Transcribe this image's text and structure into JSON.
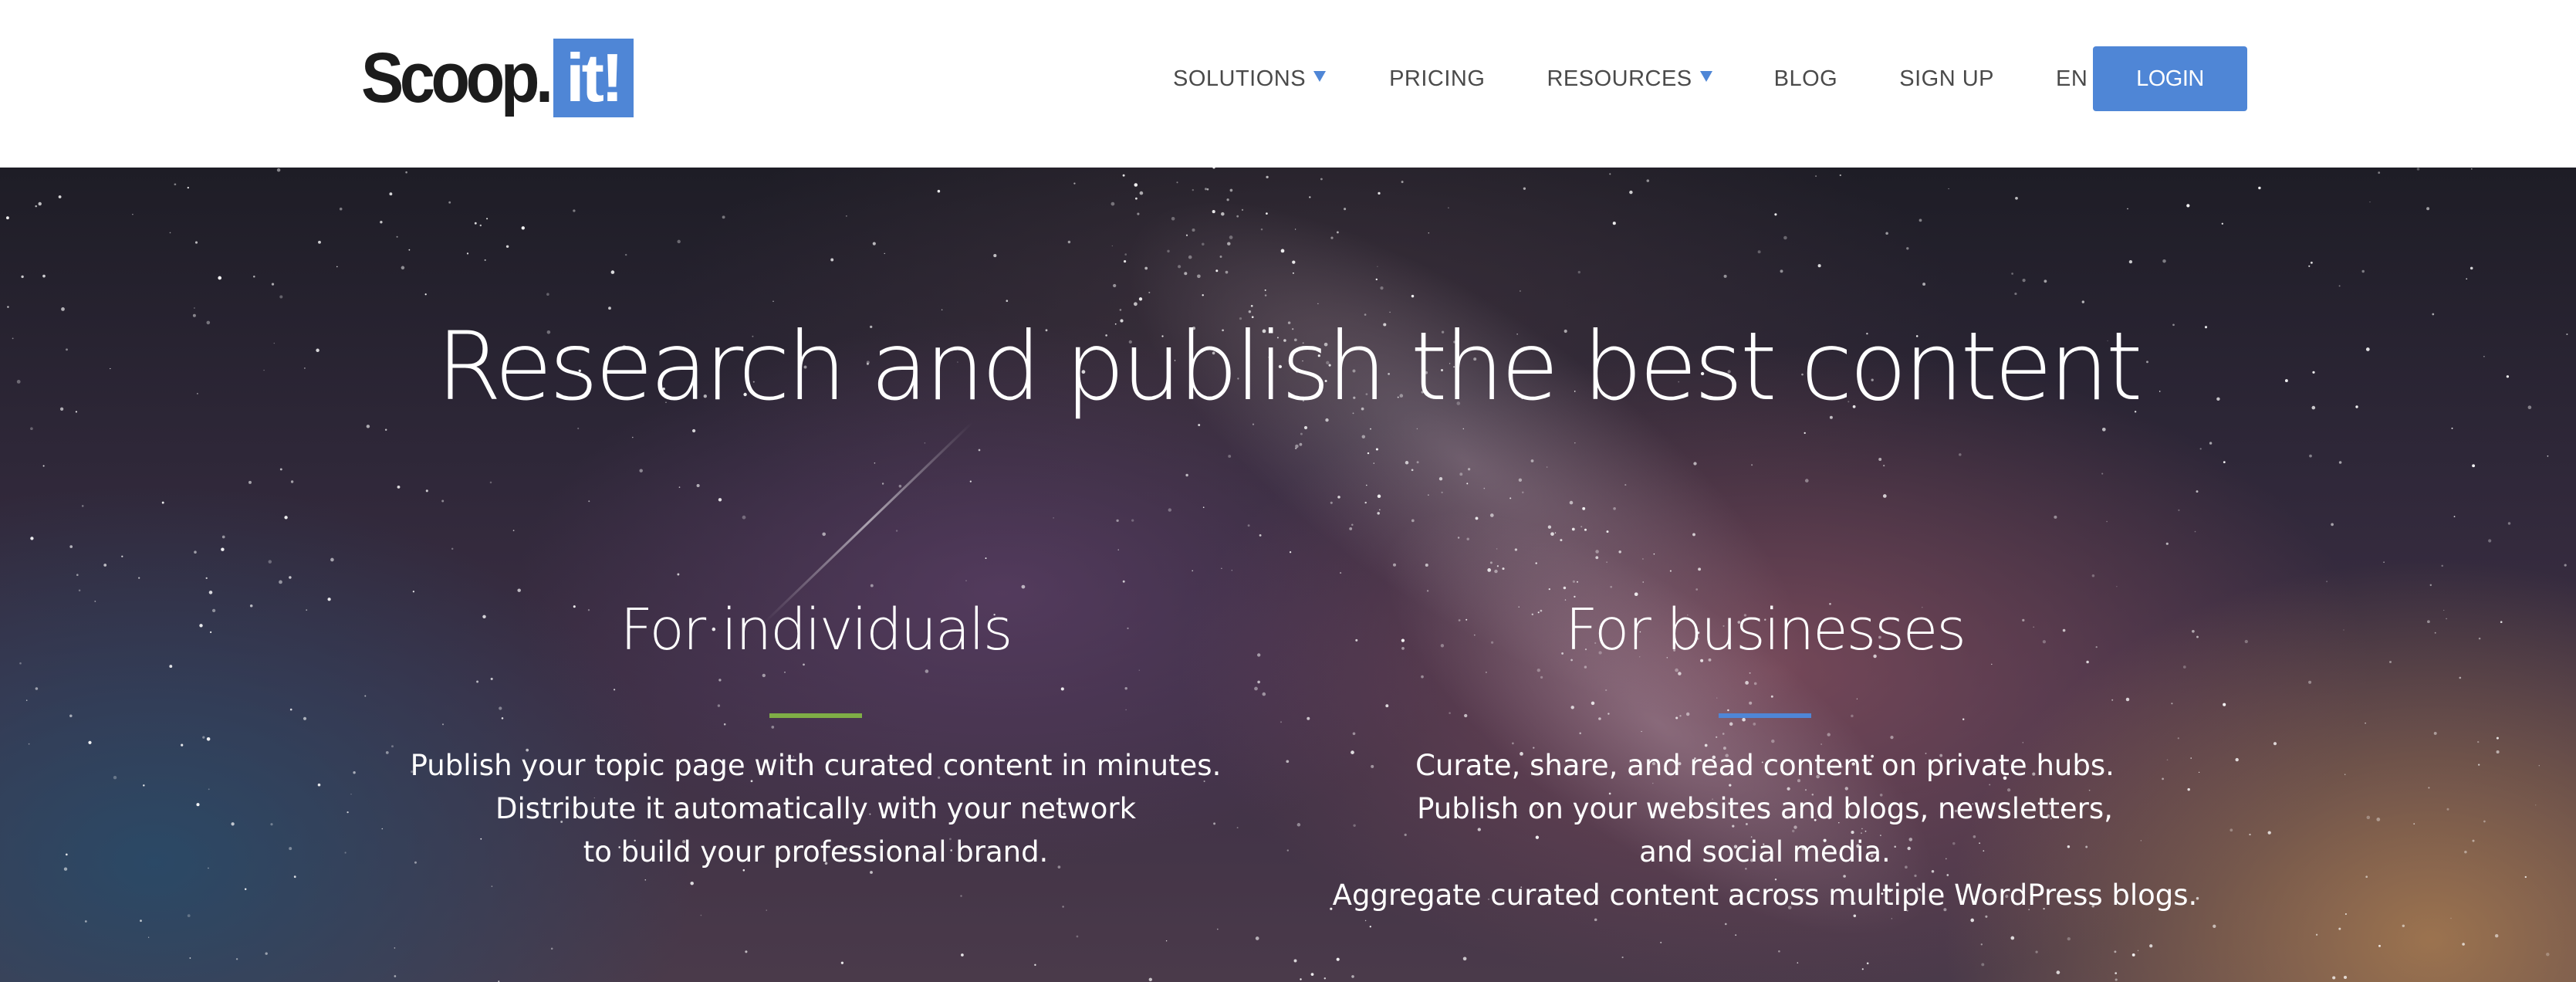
{
  "header": {
    "logo": {
      "text": "Scoop.",
      "box_text": "it!"
    },
    "nav": {
      "solutions": "SOLUTIONS",
      "pricing": "PRICING",
      "resources": "RESOURCES",
      "blog": "BLOG",
      "signup": "SIGN UP",
      "language": "EN"
    },
    "login_label": "LOGIN"
  },
  "hero": {
    "title": "Research and publish the best content",
    "individuals": {
      "title": "For individuals",
      "lines": [
        "Publish your topic page with curated content in minutes.",
        "Distribute it automatically with your network",
        "to build your professional brand."
      ]
    },
    "businesses": {
      "title": "For businesses",
      "lines": [
        "Curate, share, and read content on private hubs.",
        "Publish on your websites and blogs, newsletters,",
        "and social media.",
        "Aggregate curated content across multiple WordPress blogs."
      ]
    }
  },
  "colors": {
    "brand_blue": "#4f86d6",
    "individuals_accent": "#7fae46",
    "businesses_accent": "#4f86d6",
    "nav_text": "#4a4a4a"
  },
  "icons": {
    "solutions_caret": "caret-down-icon",
    "resources_caret": "caret-down-icon"
  }
}
